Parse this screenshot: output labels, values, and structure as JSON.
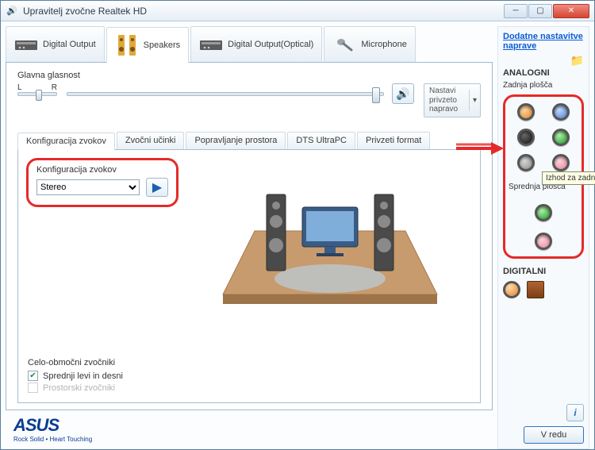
{
  "window": {
    "title": "Upravitelj zvočne Realtek HD"
  },
  "device_tabs": [
    {
      "label": "Digital Output"
    },
    {
      "label": "Speakers"
    },
    {
      "label": "Digital Output(Optical)"
    },
    {
      "label": "Microphone"
    }
  ],
  "volume": {
    "section_label": "Glavna glasnost",
    "left_label": "L",
    "right_label": "R"
  },
  "default_device": {
    "label": "Nastavi privzeto napravo"
  },
  "sub_tabs": [
    {
      "label": "Konfiguracija zvokov"
    },
    {
      "label": "Zvočni učinki"
    },
    {
      "label": "Popravljanje prostora"
    },
    {
      "label": "DTS UltraPC"
    },
    {
      "label": "Privzeti format"
    }
  ],
  "speaker_config": {
    "label": "Konfiguracija zvokov",
    "selected": "Stereo"
  },
  "fullrange": {
    "title": "Celo-območni zvočniki",
    "front": "Sprednji levi in desni",
    "surround": "Prostorski zvočniki"
  },
  "right_panel": {
    "extra_settings": "Dodatne nastavitve naprave",
    "analog_title": "ANALOGNI",
    "back_panel": "Zadnja plošča",
    "front_panel": "Sprednja plošča",
    "digital_title": "DIGITALNI",
    "tooltip": "Izhod za zadnji zvočnik (Speakers)"
  },
  "footer": {
    "brand": "ASUS",
    "tagline": "Rock Solid • Heart Touching",
    "ok": "V redu"
  }
}
